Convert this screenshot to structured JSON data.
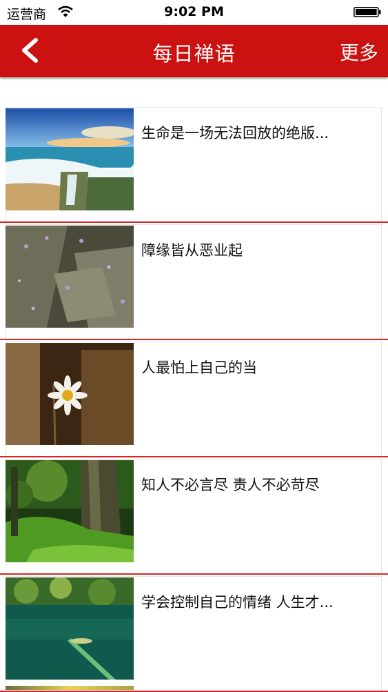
{
  "status_bar": {
    "carrier": "运营商",
    "time": "9:02 PM"
  },
  "nav": {
    "back_icon": "chevron-left-icon",
    "title": "每日禅语",
    "more_label": "更多"
  },
  "accent_color": "#cc1111",
  "items": [
    {
      "text": "生命是一场无法回放的绝版...",
      "image": "seashore-waterfall-image"
    },
    {
      "text": "障缘皆从恶业起",
      "image": "mossy-stone-path-image"
    },
    {
      "text": "人最怕上自己的当",
      "image": "daisy-on-tree-stump-image"
    },
    {
      "text": "知人不必言尽 责人不必苛尽",
      "image": "green-moss-forest-image"
    },
    {
      "text": "学会控制自己的情绪 人生才...",
      "image": "green-lake-reflection-image"
    }
  ]
}
